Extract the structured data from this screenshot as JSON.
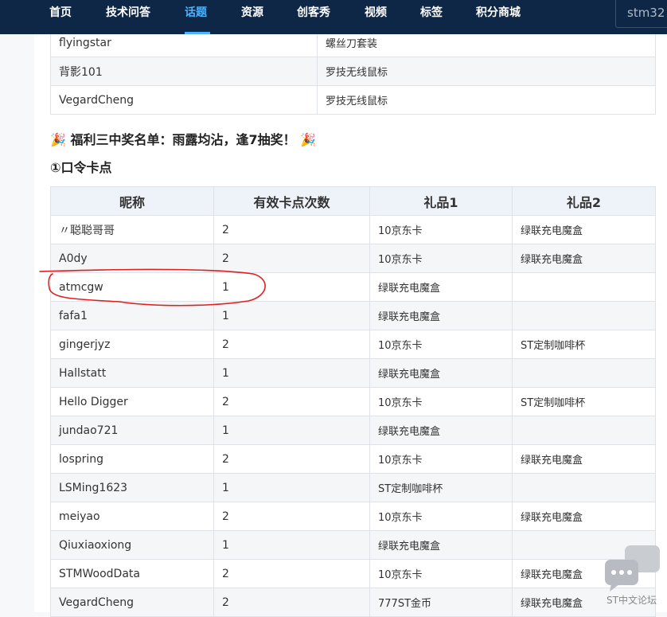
{
  "nav": {
    "items": [
      "首页",
      "技术问答",
      "话题",
      "资源",
      "创客秀",
      "视频",
      "标签",
      "积分商城"
    ],
    "active_index": 2,
    "search_text": "stm32"
  },
  "top_table": {
    "rows": [
      [
        "flyingstar",
        "螺丝刀套装"
      ],
      [
        "背影101",
        "罗技无线鼠标"
      ],
      [
        "VegardCheng",
        "罗技无线鼠标"
      ]
    ]
  },
  "section_title": "福利三中奖名单：雨露均沾，逢7抽奖！",
  "subsection_title": "①口令卡点",
  "main_table": {
    "headers": [
      "昵称",
      "有效卡点次数",
      "礼品1",
      "礼品2"
    ],
    "rows": [
      [
        "〃聪聪哥哥",
        "2",
        "10京东卡",
        "绿联充电魔盒"
      ],
      [
        "A0dy",
        "2",
        "10京东卡",
        "绿联充电魔盒"
      ],
      [
        "atmcgw",
        "1",
        "绿联充电魔盒",
        ""
      ],
      [
        "fafa1",
        "1",
        "绿联充电魔盒",
        ""
      ],
      [
        "gingerjyz",
        "2",
        "10京东卡",
        "ST定制咖啡杯"
      ],
      [
        "Hallstatt",
        "1",
        "绿联充电魔盒",
        ""
      ],
      [
        "Hello Digger",
        "2",
        "10京东卡",
        "ST定制咖啡杯"
      ],
      [
        "jundao721",
        "1",
        "绿联充电魔盒",
        ""
      ],
      [
        "lospring",
        "2",
        "10京东卡",
        "绿联充电魔盒"
      ],
      [
        "LSMing1623",
        "1",
        "ST定制咖啡杯",
        ""
      ],
      [
        "meiyao",
        "2",
        "10京东卡",
        "绿联充电魔盒"
      ],
      [
        "Qiuxiaoxiong",
        "1",
        "绿联充电魔盒",
        ""
      ],
      [
        "STMWoodData",
        "2",
        "10京东卡",
        "绿联充电魔盒"
      ],
      [
        "VegardCheng",
        "2",
        "777ST金币",
        "绿联充电魔盒"
      ]
    ]
  },
  "forum_badge": {
    "label": "ST中文论坛",
    "icon": "chat-bubbles-icon"
  },
  "colors": {
    "nav_bg": "#0f2747",
    "nav_active": "#4db3ff",
    "annotation": "#e02020",
    "header_bg": "#eef3fa"
  }
}
